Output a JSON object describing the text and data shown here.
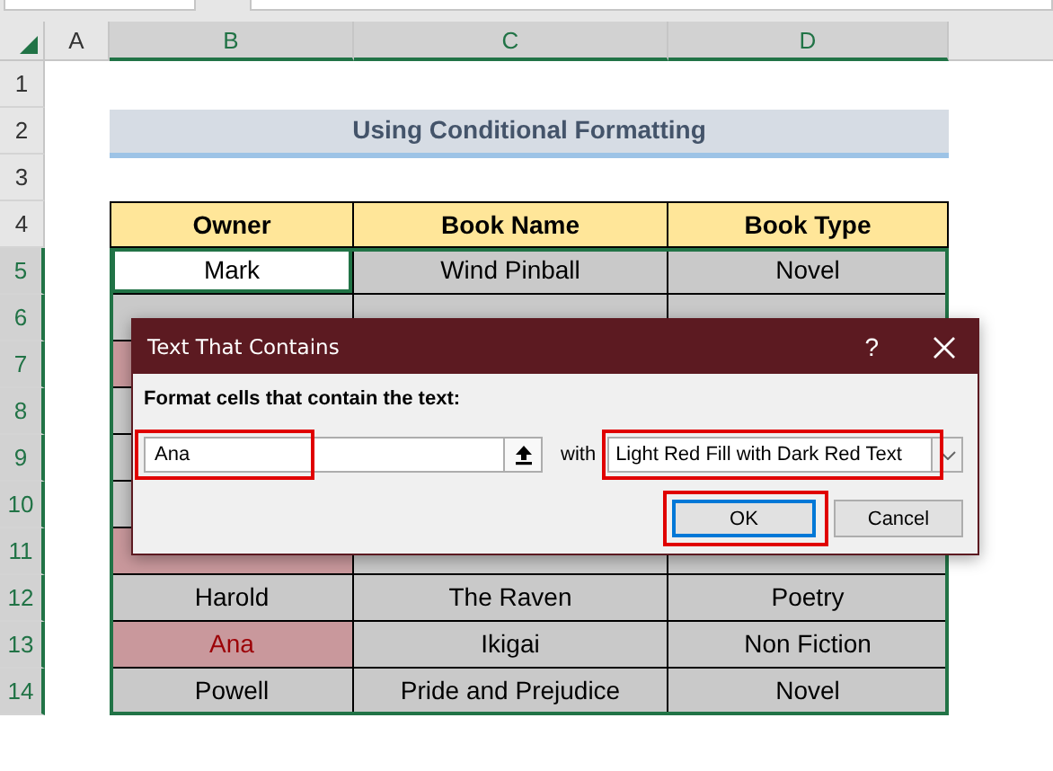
{
  "column_headers": [
    {
      "label": "A",
      "selected": false
    },
    {
      "label": "B",
      "selected": true
    },
    {
      "label": "C",
      "selected": true
    },
    {
      "label": "D",
      "selected": true
    }
  ],
  "row_numbers": [
    {
      "label": "1",
      "selected": false
    },
    {
      "label": "2",
      "selected": false
    },
    {
      "label": "3",
      "selected": false
    },
    {
      "label": "4",
      "selected": false
    },
    {
      "label": "5",
      "selected": true
    },
    {
      "label": "6",
      "selected": true
    },
    {
      "label": "7",
      "selected": true
    },
    {
      "label": "8",
      "selected": true
    },
    {
      "label": "9",
      "selected": true
    },
    {
      "label": "10",
      "selected": true
    },
    {
      "label": "11",
      "selected": true
    },
    {
      "label": "12",
      "selected": true
    },
    {
      "label": "13",
      "selected": true
    },
    {
      "label": "14",
      "selected": true
    }
  ],
  "title": "Using Conditional Formatting",
  "table": {
    "columns": [
      "Owner",
      "Book Name",
      "Book Type"
    ],
    "rows": [
      {
        "selected": true,
        "matched": false,
        "cells": [
          "Mark",
          "Wind Pinball",
          "Novel"
        ]
      },
      {
        "selected": false,
        "matched": false
      },
      {
        "selected": false,
        "matched": true
      },
      {
        "selected": false,
        "matched": false
      },
      {
        "selected": false,
        "matched": false
      },
      {
        "selected": false,
        "matched": false
      },
      {
        "selected": false,
        "matched": true
      },
      {
        "selected": false,
        "matched": false,
        "cells": [
          "Harold",
          "The Raven",
          "Poetry"
        ]
      },
      {
        "selected": false,
        "matched": true,
        "cells": [
          "Ana",
          "Ikigai",
          "Non Fiction"
        ]
      },
      {
        "selected": false,
        "matched": false,
        "cells": [
          "Powell",
          "Pride and Prejudice",
          "Novel"
        ]
      }
    ]
  },
  "dialog": {
    "title": "Text That Contains",
    "help": "?",
    "prompt": "Format cells that contain the text:",
    "input": {
      "value": "Ana",
      "highlighted": true
    },
    "with": "with",
    "format": {
      "value": "Light Red Fill with Dark Red Text",
      "highlighted": true
    },
    "buttons": [
      {
        "label": "OK",
        "default": true,
        "highlighted": true
      },
      {
        "label": "Cancel",
        "default": false,
        "highlighted": false
      }
    ]
  }
}
